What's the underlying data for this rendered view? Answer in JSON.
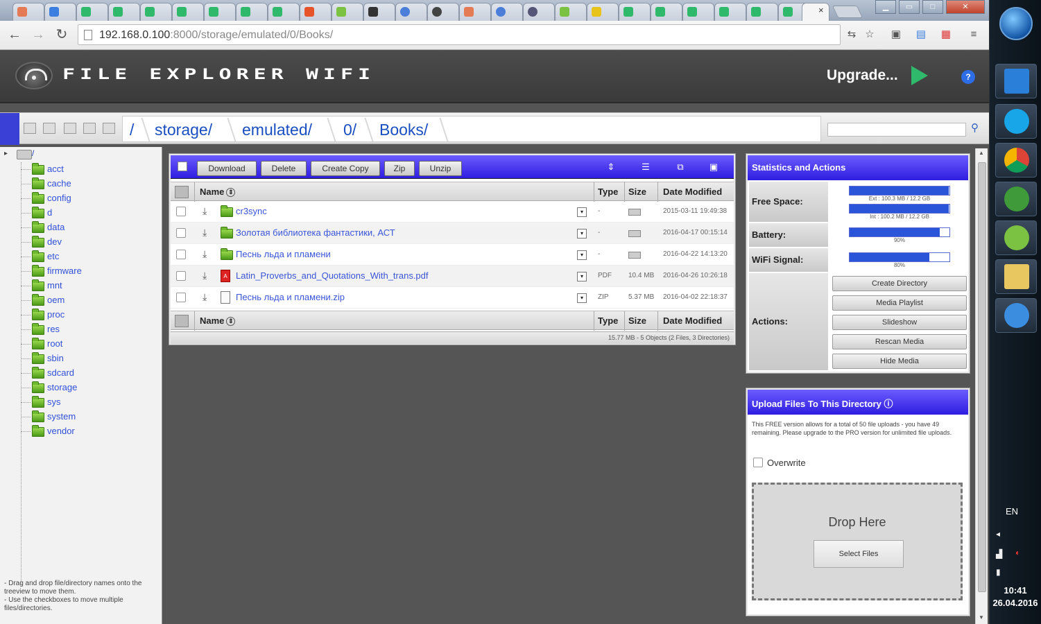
{
  "browser": {
    "address": {
      "host": "192.168.0.100",
      "port_path": ":8000/storage/emulated/0/Books/"
    },
    "active_tab_label": "",
    "close_tab": "×"
  },
  "app": {
    "title": "FILE EXPLORER WIFI",
    "upgrade": "Upgrade...",
    "help": "?"
  },
  "path": {
    "crumbs": [
      "/",
      "storage/",
      "emulated/",
      "0/",
      "Books/"
    ]
  },
  "tree": {
    "root_label": "/",
    "folders": [
      "acct",
      "cache",
      "config",
      "d",
      "data",
      "dev",
      "etc",
      "firmware",
      "mnt",
      "oem",
      "proc",
      "res",
      "root",
      "sbin",
      "sdcard",
      "storage",
      "sys",
      "system",
      "vendor"
    ],
    "hint": [
      "- Drag and drop file/directory names onto the treeview to move them.",
      "- Use the checkboxes to move multiple files/directories."
    ]
  },
  "files": {
    "buttons": [
      "Download",
      "Delete",
      "Create Copy",
      "Zip",
      "Unzip"
    ],
    "columns": {
      "name": "Name",
      "type": "Type",
      "size": "Size",
      "date": "Date Modified"
    },
    "rows": [
      {
        "name": "cr3sync",
        "kind": "folder",
        "type": "-",
        "size": "",
        "date": "2015-03-11 19:49:38"
      },
      {
        "name": "Золотая библиотека фантастики, АСТ",
        "kind": "folder",
        "type": "-",
        "size": "",
        "date": "2016-04-17 00:15:14"
      },
      {
        "name": "Песнь льда и пламени",
        "kind": "folder",
        "type": "-",
        "size": "",
        "date": "2016-04-22 14:13:20"
      },
      {
        "name": "Latin_Proverbs_and_Quotations_With_trans.pdf",
        "kind": "pdf",
        "type": "PDF",
        "size": "10.4 MB",
        "date": "2016-04-26 10:26:18"
      },
      {
        "name": "Песнь льда и пламени.zip",
        "kind": "zip",
        "type": "ZIP",
        "size": "5.37 MB",
        "date": "2016-04-02 22:18:37"
      }
    ],
    "footer": "15.77 MB - 5 Objects (2 Files, 3 Directories)"
  },
  "stats": {
    "title": "Statistics and Actions",
    "free_space_label": "Free Space:",
    "ext_text": "Ext : 100.3 MB / 12.2 GB",
    "ext_fraction": 0.99,
    "int_text": "Int : 100.2 MB / 12.2 GB",
    "int_fraction": 0.99,
    "battery_label": "Battery:",
    "battery_text": "90%",
    "battery_fraction": 0.9,
    "wifi_label": "WiFi Signal:",
    "wifi_text": "80%",
    "wifi_fraction": 0.8,
    "actions_label": "Actions:",
    "actions": [
      "Create Directory",
      "Media Playlist",
      "Slideshow",
      "Rescan Media",
      "Hide Media"
    ]
  },
  "upload": {
    "title": "Upload Files To This Directory",
    "info": "This FREE version allows for a total of 50 file uploads - you have 49 remaining. Please upgrade to the PRO version for unlimited file uploads.",
    "overwrite": "Overwrite",
    "drop": "Drop Here",
    "select": "Select Files"
  },
  "taskbar": {
    "lang": "EN",
    "time": "10:41",
    "date": "26.04.2016"
  },
  "colors": {
    "accent": "#2f1de0",
    "link": "#3050d8",
    "folder": "#4b9a18"
  }
}
